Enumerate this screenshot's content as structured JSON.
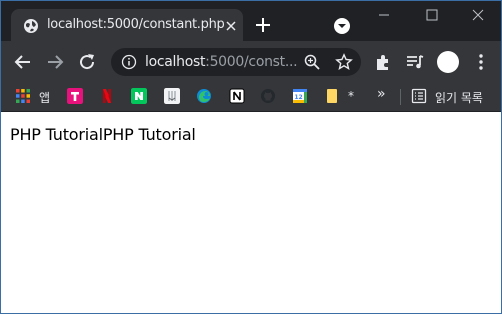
{
  "tab": {
    "title": "localhost:5000/constant.php",
    "favicon": "globe-icon"
  },
  "omnibox": {
    "host": "localhost",
    "rest": ":5000/const..."
  },
  "bookmarks": {
    "apps_label": "앱",
    "star_label": "*",
    "more_label": "»",
    "reading_list_label": "읽기 목록",
    "items": [
      "T",
      "N",
      "N",
      "V",
      "edge",
      "notion",
      "github",
      "12",
      "folder"
    ]
  },
  "page": {
    "text": "PHP TutorialPHP Tutorial"
  },
  "colors": {
    "frame": "#202124",
    "toolbar": "#35363a",
    "omnibox": "#202124",
    "text_light": "#e8eaed",
    "text_dim": "#9aa0a6"
  }
}
